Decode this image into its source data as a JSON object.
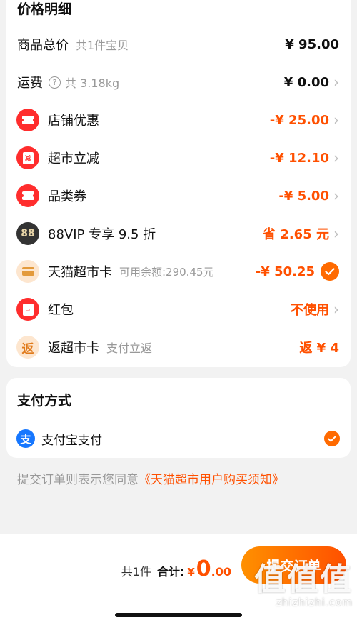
{
  "price_section": {
    "title": "价格明细",
    "items": [
      {
        "label": "商品总价",
        "sub": "共1件宝贝",
        "value": "¥ 95.00"
      },
      {
        "label": "运费",
        "sub": "共 3.18kg",
        "value": "¥ 0.00"
      },
      {
        "label": "店铺优惠",
        "value": "-¥ 25.00",
        "icon": "coupon-icon"
      },
      {
        "label": "超市立减",
        "value": "-¥ 12.10",
        "icon": "discount-icon",
        "icon_text": "减"
      },
      {
        "label": "品类券",
        "value": "-¥ 5.00",
        "icon": "coupon-icon"
      },
      {
        "label": "88VIP 专享 9.5 折",
        "value": "省 2.65 元",
        "icon": "88vip-icon",
        "icon_text": "88"
      },
      {
        "label": "天猫超市卡",
        "sub": "可用余额:290.45元",
        "value": "-¥ 50.25",
        "icon": "card-icon"
      },
      {
        "label": "红包",
        "value": "不使用",
        "icon": "red-packet-icon"
      },
      {
        "label": "返超市卡",
        "sub": "支付立返",
        "value": "返 ¥ 4",
        "icon": "rebate-icon",
        "icon_text": "返"
      }
    ]
  },
  "payment_section": {
    "title": "支付方式",
    "method": "支付宝支付",
    "icon_text": "支"
  },
  "agreement": {
    "prefix": "提交订单则表示您同意",
    "link": "《天猫超市用户购买须知》"
  },
  "bottom_bar": {
    "count": "共1件",
    "total_label": "合计:",
    "currency": "¥",
    "total_int": "0",
    "total_dec": ".00",
    "submit": "提交订单"
  },
  "watermark": {
    "big": "值值值",
    "small": "zhizhizhi.com"
  },
  "colors": {
    "accent": "#ff5000",
    "check": "#ff6a00",
    "alipay": "#1677ff"
  }
}
